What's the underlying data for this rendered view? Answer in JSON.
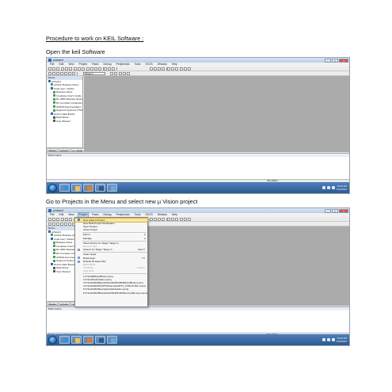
{
  "headings": {
    "title": "Procedure to work on KEIL Software :",
    "open": "Open the keil Software",
    "goto": "Go to Projects in the Menu and select new µ Vision project"
  },
  "app": {
    "window_title": "µVision4",
    "menu": [
      "File",
      "Edit",
      "View",
      "Project",
      "Flash",
      "Debug",
      "Peripherals",
      "Tools",
      "SVCS",
      "Window",
      "Help"
    ],
    "target_combo": "Target 1",
    "panel_header": "Books",
    "books_tree": [
      {
        "label": "µVision4",
        "level": 0,
        "icon": "book-icon"
      },
      {
        "label": "µVision Release Notes",
        "level": 1,
        "icon": "document-icon"
      },
      {
        "label": "Code Gen / Studio",
        "level": 1,
        "icon": "book-icon"
      },
      {
        "label": "Release Notes",
        "level": 2,
        "icon": "document-icon"
      },
      {
        "label": "Complete User's Guide S",
        "level": 2,
        "icon": "document-icon"
      },
      {
        "label": "RL-ARM Release Notes",
        "level": 2,
        "icon": "document-icon"
      },
      {
        "label": "RV Compiler Introduction",
        "level": 2,
        "icon": "document-icon"
      },
      {
        "label": "CMSIS Documentation",
        "level": 2,
        "icon": "document-icon"
      },
      {
        "label": "Segment Systems (Thrilp)",
        "level": 2,
        "icon": "document-icon"
      },
      {
        "label": "Device Data Books",
        "level": 1,
        "icon": "book-icon"
      },
      {
        "label": "Data Sheet",
        "level": 2,
        "icon": "chip-icon"
      },
      {
        "label": "User Manual",
        "level": 2,
        "icon": "chip-icon"
      }
    ],
    "panel_tabs": [
      "Books",
      "{} Func",
      "0→ Temp"
    ],
    "build_output_header": "Build Output",
    "status_left": "",
    "status_left_2": "Create a new µVision project",
    "status_right": "Simulation",
    "clock_time_1": "10:12 AM",
    "clock_date_1": "4/11/2013",
    "clock_time_2": "10:12 AM",
    "clock_date_2": "4/11/2013"
  },
  "project_menu": {
    "items": [
      {
        "label": "New µVision Project...",
        "highlight": true
      },
      {
        "label": "New Multi-Project Workspace..."
      },
      {
        "label": "Open Project..."
      },
      {
        "label": "Close Project"
      },
      {
        "sep": true
      },
      {
        "label": "Export",
        "arrow": "▸"
      },
      {
        "label": "Manage",
        "arrow": "▸"
      },
      {
        "sep": true
      },
      {
        "label": "Select Device for Target 'Target 1'..."
      },
      {
        "label": "Remove Item",
        "disabled": true
      },
      {
        "label": "Options for Target 'Target 1'...",
        "shortcut": "Alt+F7"
      },
      {
        "sep": true
      },
      {
        "label": "Clean target"
      },
      {
        "label": "Build target",
        "shortcut": "F7"
      },
      {
        "label": "Rebuild all target files"
      },
      {
        "label": "Batch Build...",
        "disabled": true
      },
      {
        "label": "Translate...",
        "shortcut": "Ctrl+F7",
        "disabled": true
      },
      {
        "label": "Stop build",
        "disabled": true
      },
      {
        "sep": true
      },
      {
        "label": "1 D:\\Keil\\Blinky\\Blinky.uvproj"
      },
      {
        "label": "2 D:\\Keil\\Hello\\Hello.uvproj"
      },
      {
        "label": "3 D:\\Keil\\ARM\\Boards\\Keil\\MCB2300\\Blinky\\Blinky.uvproj"
      },
      {
        "label": "4 D:\\Keil\\ARM\\RL\\RTX\\Examples\\RTX_Traffic\\Traffic.uvproj"
      },
      {
        "label": "5 D:\\Keil\\ARM\\Examples\\Hello\\Hello.uvproj"
      },
      {
        "label": "6 D:\\Keil\\ARM\\Boards\\Keil\\MCB2140\\Memory\\Memory.uvproj"
      }
    ]
  },
  "colors": {
    "editor_bg": "#ababab",
    "taskbar": "#2c5a93",
    "menu_highlight": "#f5e7a6"
  }
}
